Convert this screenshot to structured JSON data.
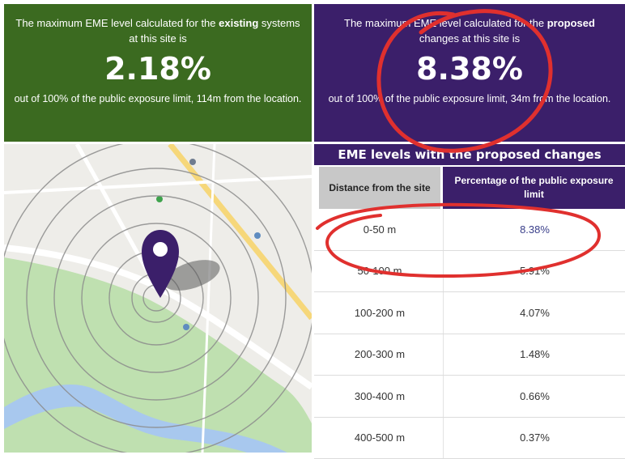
{
  "existing": {
    "intro_before": "The maximum EME level calculated for the ",
    "intro_bold": "existing",
    "intro_after": " systems at this site is",
    "value": "2.18%",
    "outro": "out of 100% of the public exposure limit, 114m from the location."
  },
  "proposed": {
    "intro_before": "The maximum EME level calculated for the ",
    "intro_bold": "proposed",
    "intro_after": " changes at this site is",
    "value": "8.38%",
    "outro": "out of 100% of the public exposure limit, 34m from the location."
  },
  "table": {
    "title": "EME levels with the proposed changes",
    "col1": "Distance from the site",
    "col2": "Percentage of the public exposure limit",
    "rows": [
      {
        "distance": "0-50 m",
        "percent": "8.38%"
      },
      {
        "distance": "50-100 m",
        "percent": "5.91%"
      },
      {
        "distance": "100-200 m",
        "percent": "4.07%"
      },
      {
        "distance": "200-300 m",
        "percent": "1.48%"
      },
      {
        "distance": "300-400 m",
        "percent": "0.66%"
      },
      {
        "distance": "400-500 m",
        "percent": "0.37%"
      }
    ]
  },
  "colors": {
    "existing_bg": "#3b6a20",
    "proposed_bg": "#3b1f6a",
    "marker": "#3b1f6a",
    "annotation": "#e0302e"
  },
  "icons": [
    "location-pin-icon"
  ]
}
